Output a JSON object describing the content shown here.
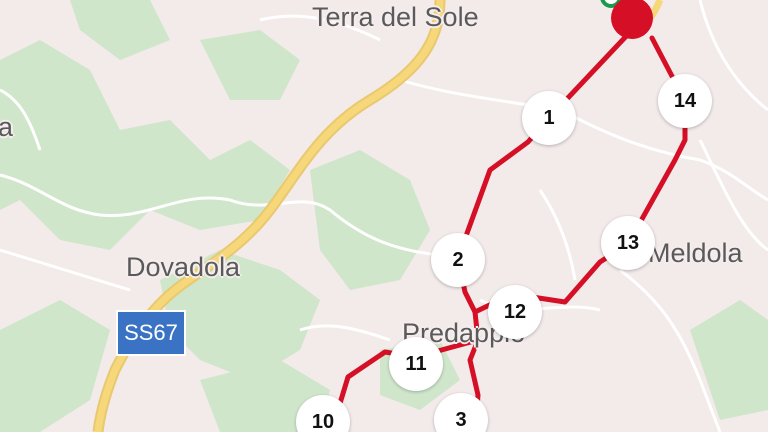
{
  "map": {
    "places": {
      "terra_del_sole": "Terra del Sole",
      "dovadola": "Dovadola",
      "predappio": "Predappio",
      "meldola": "Meldola",
      "edge_partial": "a"
    },
    "road_shield": "SS67",
    "route_color": "#d50f25",
    "road_color": "#f6d77a",
    "forest_color": "#cfe6cb",
    "stops": [
      "1",
      "2",
      "3",
      "10",
      "11",
      "12",
      "13",
      "14"
    ]
  }
}
